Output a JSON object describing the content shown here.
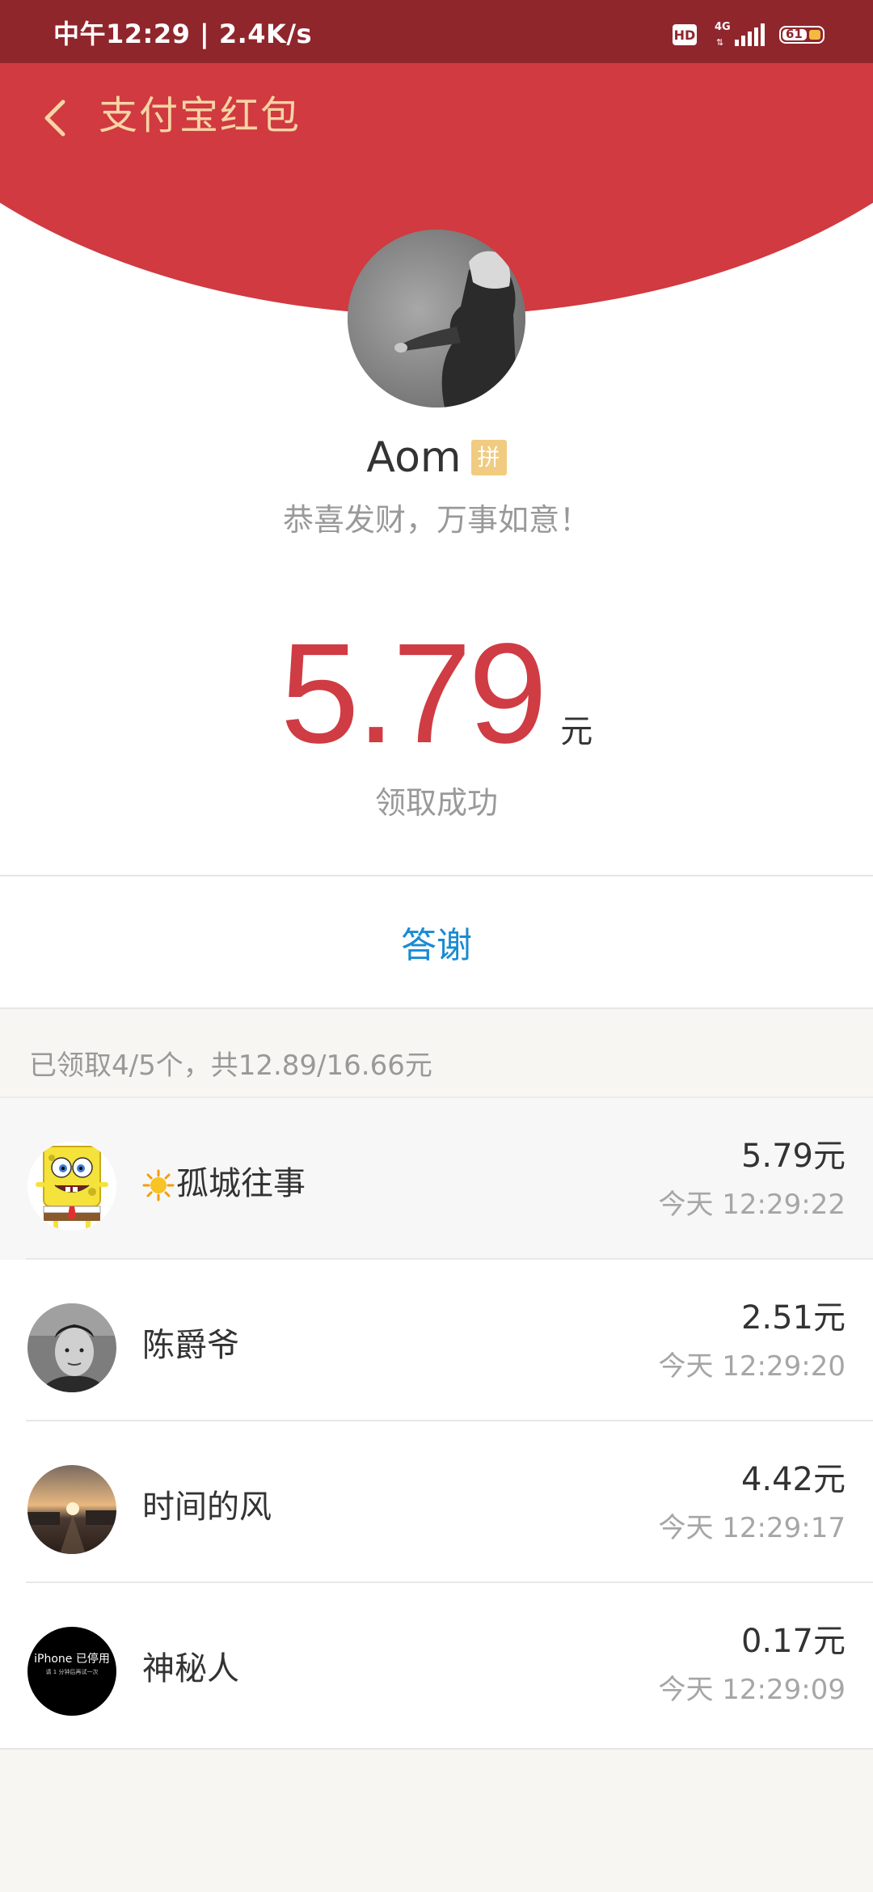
{
  "status_bar": {
    "time_speed": "中午12:29 | 2.4K/s",
    "hd_label": "HD",
    "network": "4G",
    "battery_level": "61"
  },
  "header": {
    "title": "支付宝红包",
    "back_icon": "chevron-left-icon",
    "title_color": "#f7d4a5",
    "background_color": "#d03a40"
  },
  "sender": {
    "name": "Aom",
    "badge": "拼",
    "greeting": "恭喜发财，万事如意！"
  },
  "received": {
    "amount": "5.79",
    "unit": "元",
    "status": "领取成功"
  },
  "actions": {
    "thanks_label": "答谢"
  },
  "summary": "已领取4/5个，共12.89/16.66元",
  "receivers": [
    {
      "name": "孤城往事",
      "amount": "5.79元",
      "time": "今天 12:29:22",
      "avatar": "spongebob-avatar",
      "prefix_icon": "sun-icon"
    },
    {
      "name": "陈爵爷",
      "amount": "2.51元",
      "time": "今天 12:29:20",
      "avatar": "photo-avatar"
    },
    {
      "name": "时间的风",
      "amount": "4.42元",
      "time": "今天 12:29:17",
      "avatar": "sunset-avatar"
    },
    {
      "name": "神秘人",
      "amount": "0.17元",
      "time": "今天 12:29:09",
      "avatar": "iphone-disabled-avatar",
      "avatar_text": "iPhone 已停用",
      "avatar_subtext": "请 1 分钟后再试一次"
    }
  ],
  "colors": {
    "accent_red": "#cf3c44",
    "link_blue": "#1b8bd0",
    "status_bar": "#8f262c"
  }
}
